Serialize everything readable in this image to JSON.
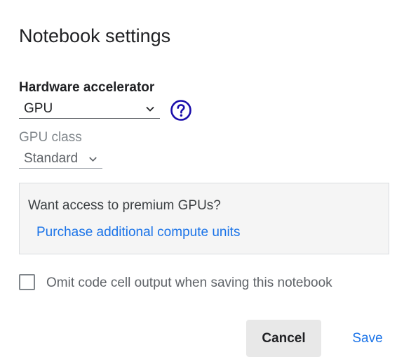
{
  "dialog": {
    "title": "Notebook settings",
    "hardware": {
      "label": "Hardware accelerator",
      "selected": "GPU",
      "chevron_icon": "chevron-down-icon",
      "help_icon": "help-circle-icon"
    },
    "gpu_class": {
      "label": "GPU class",
      "selected": "Standard",
      "chevron_icon": "chevron-down-icon"
    },
    "promo": {
      "question": "Want access to premium GPUs?",
      "link": "Purchase additional compute units"
    },
    "omit_output": {
      "label": "Omit code cell output when saving this notebook",
      "checked": false
    },
    "buttons": {
      "cancel": "Cancel",
      "save": "Save"
    }
  },
  "colors": {
    "accent": "#1a73e8",
    "help_icon": "#1a0dab",
    "text": "#202124",
    "muted": "#80868b"
  }
}
